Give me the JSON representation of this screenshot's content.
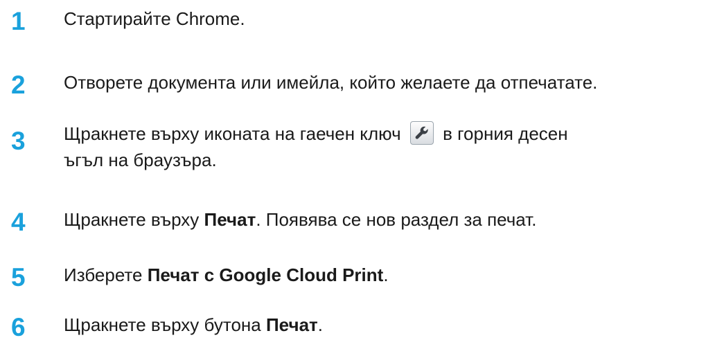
{
  "steps": [
    {
      "number": "1",
      "text": "Стартирайте Chrome."
    },
    {
      "number": "2",
      "text": "Отворете документа или имейла, който желаете да отпечатате."
    },
    {
      "number": "3",
      "text_before": "Щракнете върху иконата на гаечен ключ",
      "text_after": "в горния десен",
      "text_line2": "ъгъл на браузъра.",
      "icon": "wrench-icon"
    },
    {
      "number": "4",
      "text_before": "Щракнете върху ",
      "bold": "Печат",
      "text_after": ". Появява се нов раздел за печат."
    },
    {
      "number": "5",
      "text_before": "Изберете ",
      "bold": "Печат с Google Cloud Print",
      "text_after": "."
    },
    {
      "number": "6",
      "text_before": "Щракнете върху бутона ",
      "bold": "Печат",
      "text_after": "."
    }
  ],
  "colors": {
    "step_number": "#1aa1dc",
    "text": "#1a1a1a"
  }
}
